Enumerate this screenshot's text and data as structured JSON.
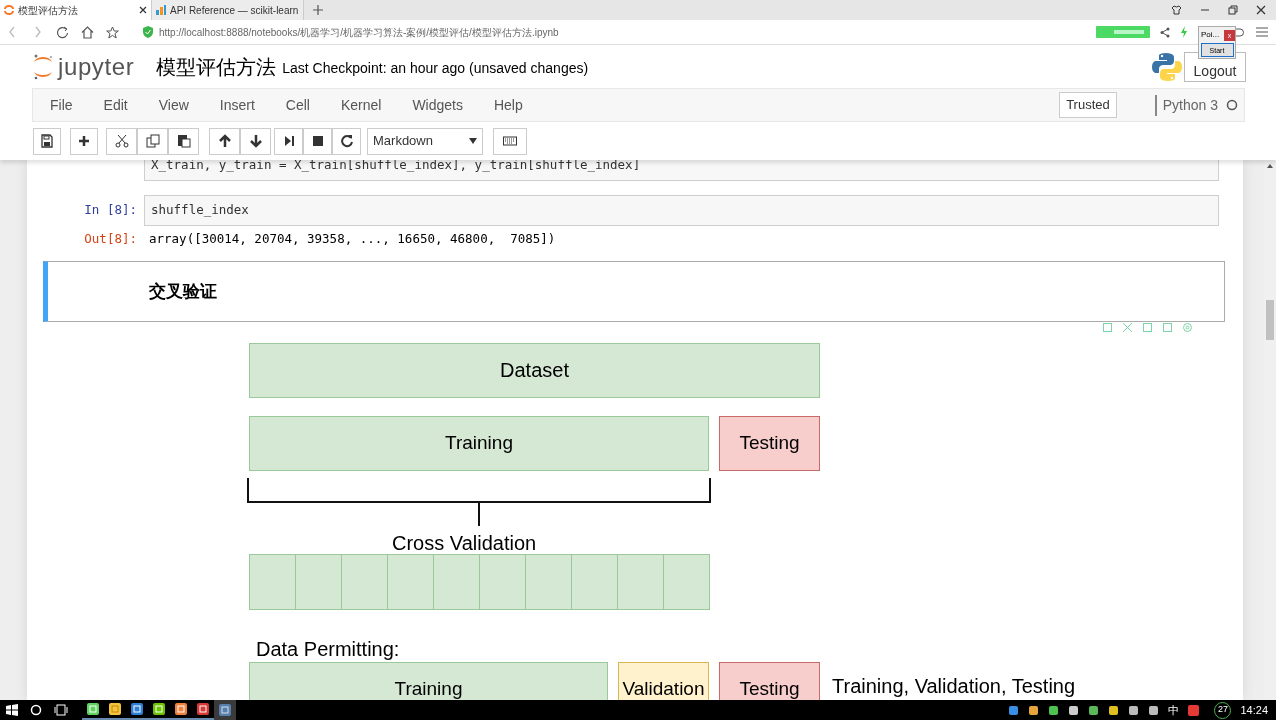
{
  "browser": {
    "tabs": [
      {
        "label": "模型评估方法",
        "selected": true
      },
      {
        "label": "API Reference — scikit-learn",
        "selected": false
      }
    ],
    "url": "http://localhost:8888/notebooks/机器学习/机器学习算法-案例/模型评估/模型评估方法.ipynb"
  },
  "popup": {
    "title": "Poi...",
    "close": "x",
    "button": "Start"
  },
  "header": {
    "logo_text": "jupyter",
    "notebook_title": "模型评估方法",
    "checkpoint": "Last Checkpoint: an hour ago (unsaved changes)",
    "logout": "Logout"
  },
  "menu": {
    "items": [
      "File",
      "Edit",
      "View",
      "Insert",
      "Cell",
      "Kernel",
      "Widgets",
      "Help"
    ],
    "trusted": "Trusted",
    "kernel": "Python 3",
    "kernel_busy": false
  },
  "toolbar": {
    "cell_type": "Markdown"
  },
  "cells": [
    {
      "kind": "code",
      "selected": false,
      "source": "X_train, y_train = X_train[shuffle_index], y_train[shuffle_index]"
    },
    {
      "kind": "code",
      "selected": false,
      "prompt": "In [8]:",
      "source": "shuffle_index",
      "output_prompt": "Out[8]:",
      "output": "array([30014, 20704, 39358, ..., 16650, 46800,  7085])"
    },
    {
      "kind": "markdown",
      "selected": true,
      "heading": "交叉验证"
    },
    {
      "kind": "diagram",
      "labels": {
        "dataset": "Dataset",
        "training": "Training",
        "testing": "Testing",
        "cross_validation": "Cross Validation",
        "data_permitting": "Data Permitting:",
        "training_2": "Training",
        "validation": "Validation",
        "testing_2": "Testing",
        "caption": "Training, Validation, Testing"
      }
    }
  ],
  "taskbar": {
    "ime": "中",
    "notifications": "27",
    "clock": "14:24"
  }
}
